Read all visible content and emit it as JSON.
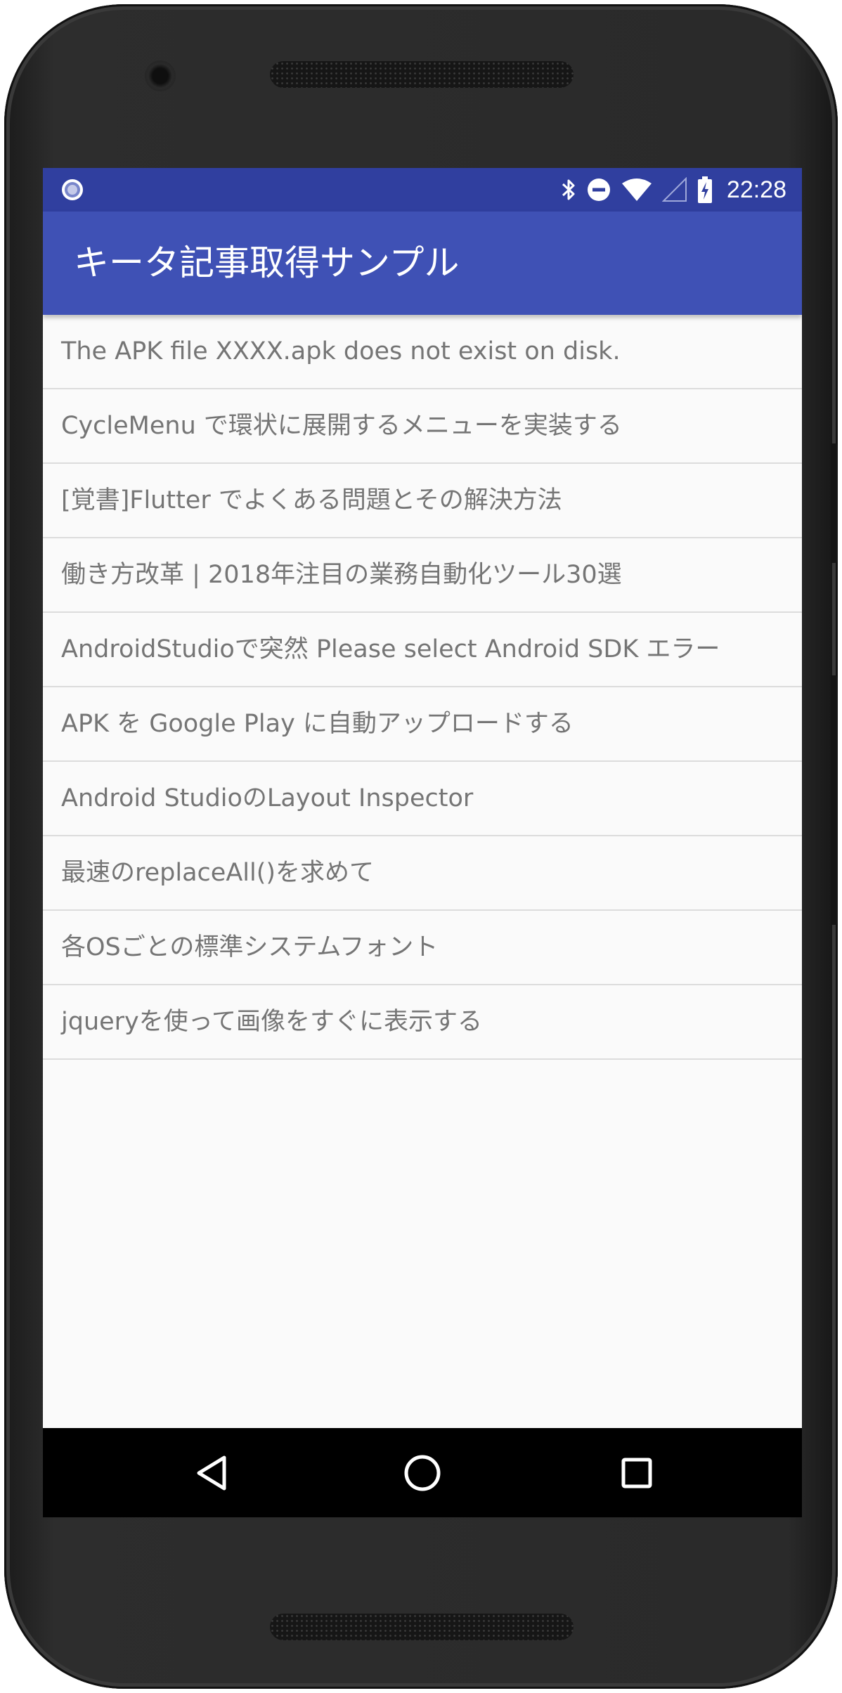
{
  "status_bar": {
    "time": "22:28",
    "icons": [
      "notification-dot-icon",
      "bluetooth-icon",
      "do-not-disturb-icon",
      "wifi-icon",
      "signal-icon",
      "battery-charging-icon"
    ]
  },
  "app_bar": {
    "title": "キータ記事取得サンプル",
    "color": "#3f51b5",
    "status_color": "#303f9f"
  },
  "articles": [
    {
      "title": "The APK file XXXX.apk does not exist on disk."
    },
    {
      "title": "CycleMenu で環状に展開するメニューを実装する"
    },
    {
      "title": "[覚書]Flutter でよくある問題とその解決方法"
    },
    {
      "title": "働き方改革 | 2018年注目の業務自動化ツール30選"
    },
    {
      "title": "AndroidStudioで突然 Please select Android SDK エラー"
    },
    {
      "title": "APK を Google Play に自動アップロードする"
    },
    {
      "title": "Android StudioのLayout Inspector"
    },
    {
      "title": "最速のreplaceAll()を求めて"
    },
    {
      "title": "各OSごとの標準システムフォント"
    },
    {
      "title": "jqueryを使って画像をすぐに表示する"
    }
  ],
  "nav_bar": {
    "icons": [
      "back-icon",
      "home-icon",
      "recent-apps-icon"
    ]
  }
}
